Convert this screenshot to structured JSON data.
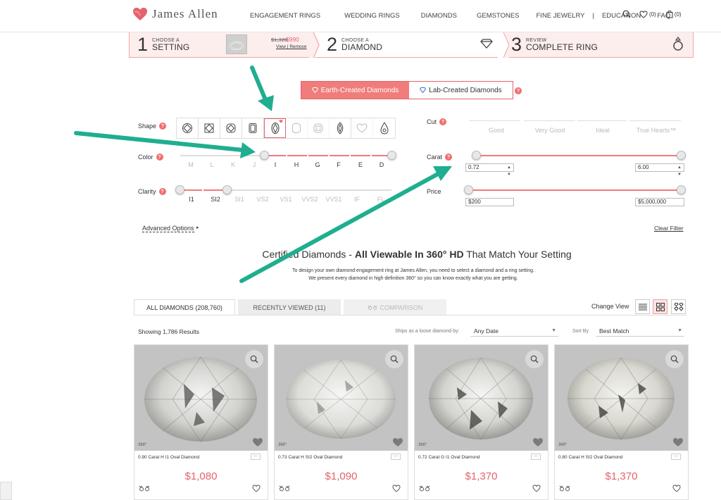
{
  "brand": {
    "name": "James Allen",
    "accent": "#e5636a",
    "pink": "#fdeeee",
    "arrow": "#1fae8f"
  },
  "nav": {
    "items": [
      "ENGAGEMENT RINGS",
      "WEDDING RINGS",
      "DIAMONDS",
      "GEMSTONES",
      "FINE JEWELRY",
      "EDUCATION",
      "FAQ"
    ],
    "separator": "|",
    "wishlist_count": "(0)",
    "cart_count": "(0)"
  },
  "steps": [
    {
      "num": "1",
      "small": "CHOOSE A",
      "big": "SETTING",
      "price_old": "$1,320",
      "price_new": "$990",
      "view": "View",
      "sep": "|",
      "remove": "Remove"
    },
    {
      "num": "2",
      "small": "CHOOSE A",
      "big": "DIAMOND"
    },
    {
      "num": "3",
      "small": "REVIEW",
      "big": "COMPLETE RING"
    }
  ],
  "toggle": {
    "earth": "Earth-Created Diamonds",
    "lab": "Lab-Created Diamonds",
    "help": "?"
  },
  "filters": {
    "shape_label": "Shape",
    "color_label": "Color",
    "clarity_label": "Clarity",
    "cut_label": "Cut",
    "carat_label": "Carat",
    "price_label": "Price",
    "help": "?",
    "color_grades": [
      "M",
      "L",
      "K",
      "J",
      "I",
      "H",
      "G",
      "F",
      "E",
      "D"
    ],
    "clarity_grades": [
      "I1",
      "SI2",
      "SI1",
      "VS2",
      "VS1",
      "VVS2",
      "VVS1",
      "IF",
      "FL"
    ],
    "cut_grades": [
      "Good",
      "Very Good",
      "Ideal",
      "True Hearts™"
    ],
    "carat_min": "0.72",
    "carat_max": "6.00",
    "price_min": "$200",
    "price_max": "$5,000,000",
    "advanced": "Advanced Options",
    "advanced_arrow": "▸",
    "clear": "Clear Filter"
  },
  "heading": {
    "part1": "Certified Diamonds - ",
    "part2": "All Viewable In 360° HD",
    "part3": " That Match Your Setting",
    "desc1": "To design your own diamond engagement ring at James Allen, you need to select a diamond and a ring setting.",
    "desc2": "We present every diamond in high definition 360° so you can know exactly what you are getting."
  },
  "tabs": {
    "all": "ALL DIAMONDS (208,760)",
    "recent": "RECENTLY VIEWED (11)",
    "compare": "COMPARISON",
    "change_view": "Change View"
  },
  "listing": {
    "results": "Showing 1,786 Results",
    "ships_label": "Ships as a loose diamond by:",
    "ships_value": "Any Date",
    "sort_label": "Sort By",
    "sort_value": "Best Match",
    "badge_360": "360°",
    "dots": "..."
  },
  "products": [
    {
      "title": "0.90 Carat H I1 Oval Diamond",
      "price": "$1,080"
    },
    {
      "title": "0.73 Carat H SI2 Oval Diamond",
      "price": "$1,090"
    },
    {
      "title": "0.72 Carat G I1 Oval Diamond",
      "price": "$1,370"
    },
    {
      "title": "0.80 Carat H SI2 Oval Diamond",
      "price": "$1,370"
    }
  ]
}
